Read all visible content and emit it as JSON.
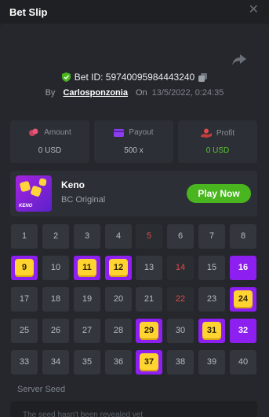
{
  "header": {
    "title": "Bet Slip"
  },
  "bet": {
    "id_label": "Bet ID: 59740095984443240",
    "by_label": "By",
    "user": "Carlosponzonia",
    "on_label": "On",
    "timestamp": "13/5/2022, 0:24:35"
  },
  "stats": {
    "amount": {
      "label": "Amount",
      "value": "0 USD"
    },
    "payout": {
      "label": "Payout",
      "value": "500 x"
    },
    "profit": {
      "label": "Profit",
      "value": "0 USD"
    }
  },
  "game": {
    "name": "Keno",
    "provider": "BC Original",
    "thumb_text": "KENO",
    "play_label": "Play Now"
  },
  "keno": {
    "numbers": [
      "1",
      "2",
      "3",
      "4",
      "5",
      "6",
      "7",
      "8",
      "9",
      "10",
      "11",
      "12",
      "13",
      "14",
      "15",
      "16",
      "17",
      "18",
      "19",
      "20",
      "21",
      "22",
      "23",
      "24",
      "25",
      "26",
      "27",
      "28",
      "29",
      "30",
      "31",
      "32",
      "33",
      "34",
      "35",
      "36",
      "37",
      "38",
      "39",
      "40"
    ],
    "hits": [
      9,
      11,
      12,
      24,
      29,
      31,
      37
    ],
    "drawn_only": [
      5,
      14,
      22
    ],
    "picked_only": [
      16,
      32
    ]
  },
  "seed": {
    "label": "Server Seed",
    "placeholder": "The seed hasn't been revealed yet"
  },
  "colors": {
    "accent_green": "#49b51f",
    "pick_purple": "#8d1ff0",
    "hit_yellow": "#ffd430",
    "drawn_red": "#e04b48"
  }
}
